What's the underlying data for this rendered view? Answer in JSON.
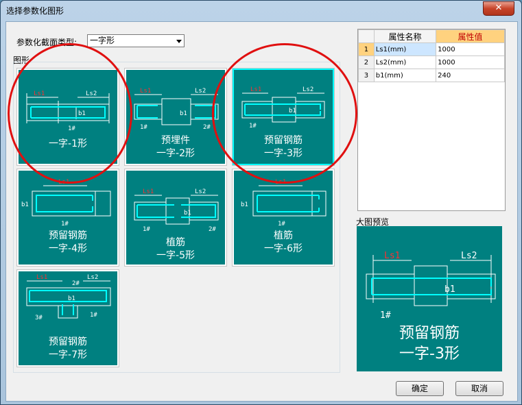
{
  "window": {
    "title": "选择参数化图形",
    "close_glyph": "✕"
  },
  "section_type": {
    "label": "参数化截面类型:",
    "selected": "一字形"
  },
  "shapes_group_label": "图形",
  "tiles": [
    {
      "line1": "一字-1形",
      "line2": ""
    },
    {
      "line1": "预埋件",
      "line2": "一字-2形"
    },
    {
      "line1": "预留钢筋",
      "line2": "一字-3形"
    },
    {
      "line1": "预留钢筋",
      "line2": "一字-4形"
    },
    {
      "line1": "植筋",
      "line2": "一字-5形"
    },
    {
      "line1": "植筋",
      "line2": "一字-6形"
    },
    {
      "line1": "预留钢筋",
      "line2": "一字-7形"
    }
  ],
  "drawing_labels": {
    "ls1": "Ls1",
    "ls2": "Ls2",
    "b1": "b1",
    "bar1": "1#",
    "bar2": "2#",
    "bar3": "3#"
  },
  "properties": {
    "col_name": "属性名称",
    "col_value": "属性值",
    "rows": [
      {
        "n": "1",
        "name": "Ls1(mm)",
        "value": "1000"
      },
      {
        "n": "2",
        "name": "Ls2(mm)",
        "value": "1000"
      },
      {
        "n": "3",
        "name": "b1(mm)",
        "value": "240"
      }
    ]
  },
  "preview": {
    "label": "大图预览",
    "line1": "预留钢筋",
    "line2": "一字-3形"
  },
  "buttons": {
    "ok": "确定",
    "cancel": "取消"
  },
  "colors": {
    "tile_bg": "#008080",
    "rebar": "#00ffff",
    "dim_red": "#ff3030",
    "selected_border": "#00ffff",
    "annotation_circle": "#e01010"
  }
}
